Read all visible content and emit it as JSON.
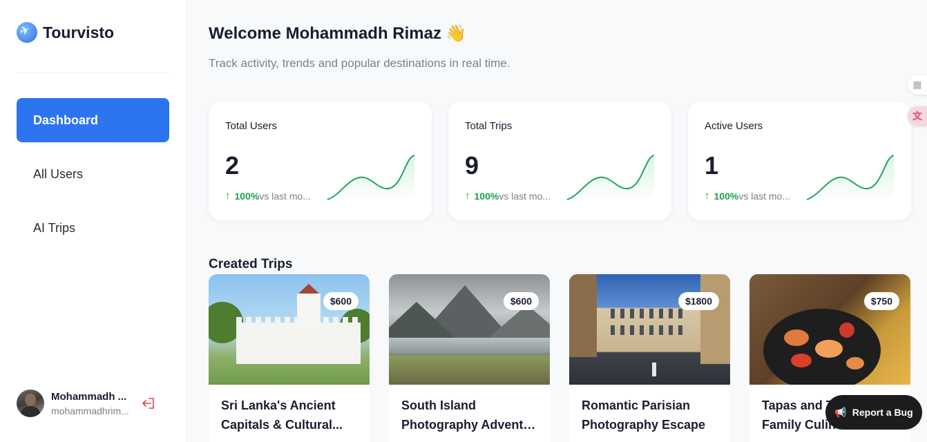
{
  "brand": {
    "name": "Tourvisto",
    "logo_icon": "plane-globe-icon"
  },
  "sidebar": {
    "items": [
      {
        "label": "Dashboard",
        "active": true
      },
      {
        "label": "All Users",
        "active": false
      },
      {
        "label": "AI Trips",
        "active": false
      }
    ],
    "user": {
      "name": "Mohammadh ...",
      "email": "mohammadhrim..."
    }
  },
  "header": {
    "welcome": "Welcome Mohammadh Rimaz",
    "wave_emoji": "👋",
    "subtitle": "Track activity, trends and popular destinations in real time."
  },
  "stats": [
    {
      "label": "Total Users",
      "value": "2",
      "pct": "100%",
      "text": "vs last mo..."
    },
    {
      "label": "Total Trips",
      "value": "9",
      "pct": "100%",
      "text": "vs last mo..."
    },
    {
      "label": "Active Users",
      "value": "1",
      "pct": "100%",
      "text": "vs last mo..."
    }
  ],
  "trips_section": {
    "title": "Created Trips",
    "trips": [
      {
        "price": "$600",
        "title_line1": "Sri Lanka's Ancient",
        "title_line2": "Capitals & Cultural..."
      },
      {
        "price": "$600",
        "title_line1": "South Island",
        "title_line2": "Photography Adventur..."
      },
      {
        "price": "$1800",
        "title_line1": "Romantic Parisian",
        "title_line2": "Photography Escape"
      },
      {
        "price": "$750",
        "title_line1": "Tapas and T",
        "title_line2": "Family Culin"
      }
    ]
  },
  "report_button": {
    "label": "Report a Bug"
  },
  "colors": {
    "accent": "#2d74f0",
    "positive": "#16a34a",
    "text": "#1a1d2e",
    "muted": "#7b7f8c"
  }
}
